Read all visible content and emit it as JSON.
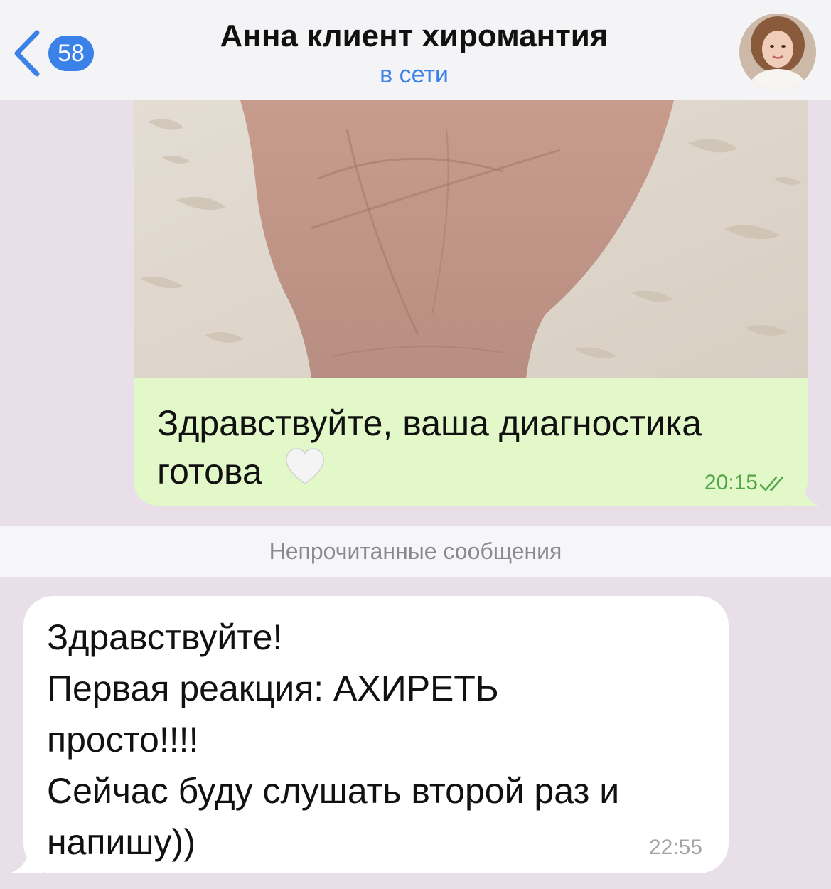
{
  "header": {
    "back_badge": "58",
    "title": "Анна клиент хиромантия",
    "status": "в сети",
    "accent_color": "#3b82e8"
  },
  "messages": [
    {
      "direction": "outgoing",
      "has_photo": true,
      "text": "Здравствуйте, ваша диагностика\nготова",
      "emoji": "white-heart",
      "time": "20:15",
      "status_icon": "double-check-icon",
      "bubble_color": "#e2f8c9",
      "time_color": "#52a548"
    },
    {
      "direction": "incoming",
      "text": "Здравствуйте!\nПервая реакция: АХИРЕТЬ\nпросто!!!!\nСейчас буду слушать второй раз и\nнапишу))",
      "time": "22:55",
      "bubble_color": "#ffffff"
    }
  ],
  "divider": {
    "label": "Непрочитанные сообщения"
  },
  "colors": {
    "chat_background": "#e9dfe8"
  }
}
